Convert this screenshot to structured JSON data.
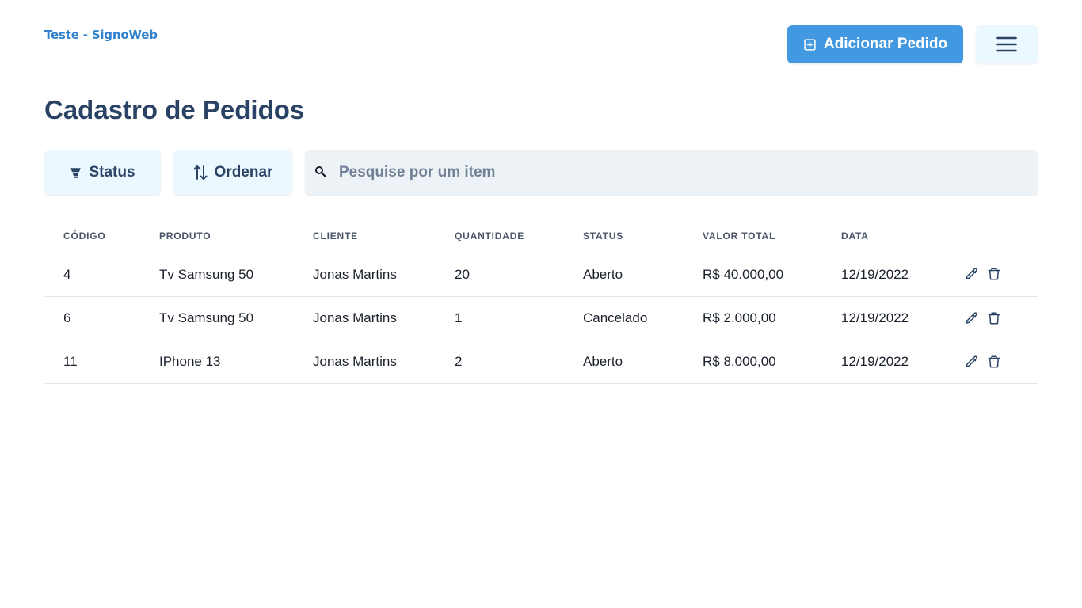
{
  "header": {
    "brand": "Teste - SignoWeb",
    "add_button": {
      "label": "Adicionar Pedido",
      "icon": "plus-square-icon"
    },
    "menu_button": {
      "icon": "hamburger-icon"
    }
  },
  "page": {
    "title": "Cadastro de Pedidos"
  },
  "toolbar": {
    "status_button": {
      "label": "Status",
      "icon": "filter-icon"
    },
    "order_button": {
      "label": "Ordenar",
      "icon": "sort-arrows-icon"
    },
    "search": {
      "placeholder": "Pesquise por um item",
      "value": "",
      "icon": "search-icon"
    }
  },
  "table": {
    "columns": [
      "CÓDIGO",
      "PRODUTO",
      "CLIENTE",
      "QUANTIDADE",
      "STATUS",
      "VALOR TOTAL",
      "DATA"
    ],
    "rows": [
      {
        "codigo": "4",
        "produto": "Tv Samsung 50",
        "cliente": "Jonas Martins",
        "quantidade": "20",
        "status": "Aberto",
        "valor_total": "R$ 40.000,00",
        "data": "12/19/2022"
      },
      {
        "codigo": "6",
        "produto": "Tv Samsung 50",
        "cliente": "Jonas Martins",
        "quantidade": "1",
        "status": "Cancelado",
        "valor_total": "R$ 2.000,00",
        "data": "12/19/2022"
      },
      {
        "codigo": "11",
        "produto": "IPhone 13",
        "cliente": "Jonas Martins",
        "quantidade": "2",
        "status": "Aberto",
        "valor_total": "R$ 8.000,00",
        "data": "12/19/2022"
      }
    ],
    "row_actions": [
      "edit-pencil-icon",
      "trash-icon"
    ]
  },
  "colors": {
    "accent": "#4299e1",
    "title": "#2a4365",
    "brand": "#3182ce",
    "light_button_bg": "#ebf8ff",
    "search_bg": "#edf2f7"
  }
}
